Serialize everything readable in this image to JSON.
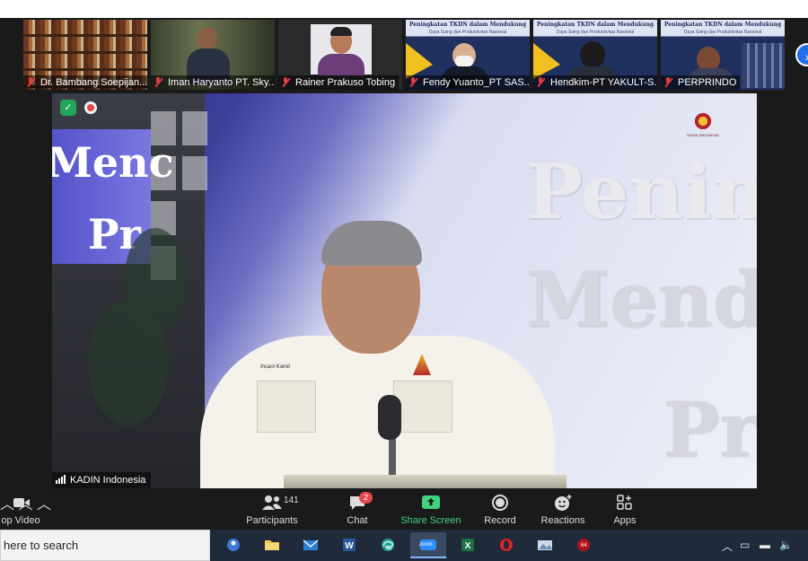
{
  "participants_strip": [
    {
      "name": "Dr. Bambang Soepijan..."
    },
    {
      "name": "Iman Haryanto PT. Sky..."
    },
    {
      "name": "Rainer Prakuso Tobing"
    },
    {
      "name": "Fendy Yuanto_PT SAS..."
    },
    {
      "name": "Hendkim-PT YAKULT-S..."
    },
    {
      "name": "PERPRINDO"
    }
  ],
  "main_video": {
    "speaker_name": "KADIN Indonesia",
    "backdrop_left_1": "Menc",
    "backdrop_left_2": "Pr",
    "backdrop_right_1": "Penin",
    "backdrop_right_2": "Mend",
    "backdrop_right_3": "Pr",
    "pocket_name": "Insani Kamil",
    "logo_caption": "KADIN INDONESIA"
  },
  "thumb_slide": {
    "line1": "Peningkatan TKDN dalam Mendukung",
    "line2": "Daya Saing dan Produktivitas Nasional"
  },
  "toolbar": {
    "video_label": "op Video",
    "participants_label": "Participants",
    "participants_count": "141",
    "chat_label": "Chat",
    "chat_badge": "2",
    "share_label": "Share Screen",
    "record_label": "Record",
    "reactions_label": "Reactions",
    "apps_label": "Apps"
  },
  "taskbar": {
    "search_placeholder": "here to search",
    "zoom_label": "zoom",
    "opera_badge": "64"
  },
  "colors": {
    "accent_blue": "#1f6feb",
    "share_green": "#3fd27f",
    "badge_red": "#e5484d",
    "toolbar_bg": "#1a1a1a"
  }
}
